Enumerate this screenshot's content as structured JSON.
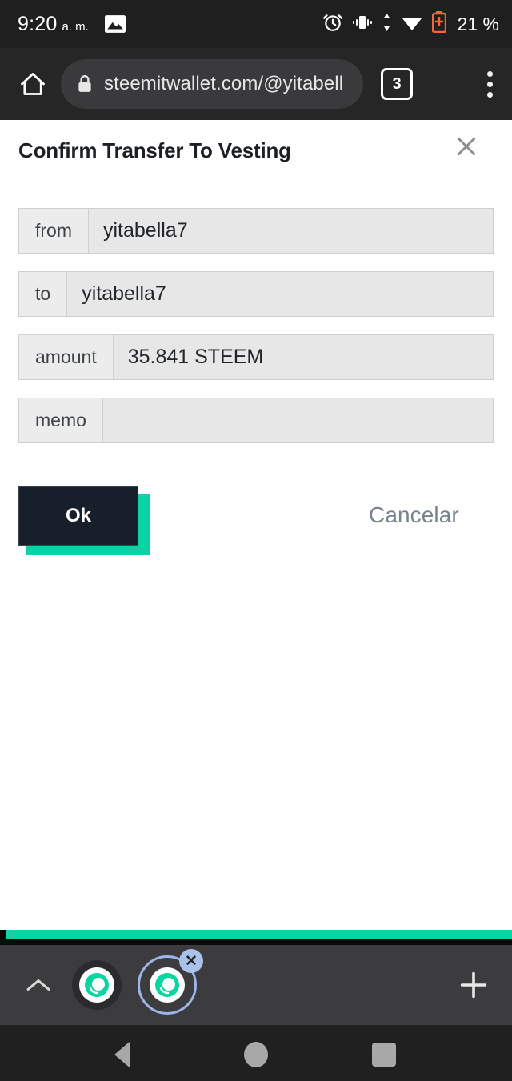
{
  "statusbar": {
    "time": "9:20",
    "ampm": "a. m.",
    "image_icon": "image-icon",
    "alarm_icon": "alarm-icon",
    "vibrate_icon": "vibrate-icon",
    "signal_icon": "data-transfer-icon",
    "wifi_icon": "wifi-icon",
    "battery_icon": "battery-charging-icon",
    "battery_pct": "21 %"
  },
  "browser": {
    "home_icon": "home-icon",
    "lock_icon": "lock-icon",
    "url": "steemitwallet.com/@yitabell",
    "tab_count": "3",
    "menu_icon": "overflow-menu-icon"
  },
  "dialog": {
    "title": "Confirm Transfer To Vesting",
    "close_icon": "close-icon",
    "fields": [
      {
        "label": "from",
        "value": "yitabella7"
      },
      {
        "label": "to",
        "value": "yitabella7"
      },
      {
        "label": "amount",
        "value": "35.841 STEEM"
      },
      {
        "label": "memo",
        "value": ""
      }
    ],
    "ok_label": "Ok",
    "cancel_label": "Cancelar"
  },
  "tabstrip": {
    "expand_icon": "chevron-up-icon",
    "tab_inactive_icon": "steem-favicon",
    "tab_active_icon": "steem-favicon",
    "tab_close_label": "✕",
    "new_tab_icon": "plus-icon"
  },
  "navbar": {
    "back_icon": "back-triangle-icon",
    "home_icon": "home-circle-icon",
    "recents_icon": "recents-square-icon"
  },
  "colors": {
    "accent_green": "#0bd3a3",
    "dark_button": "#17202a",
    "status_bar": "#1f1f1f",
    "browser_bar": "#262626",
    "tab_ring_blue": "#9db5e8"
  }
}
